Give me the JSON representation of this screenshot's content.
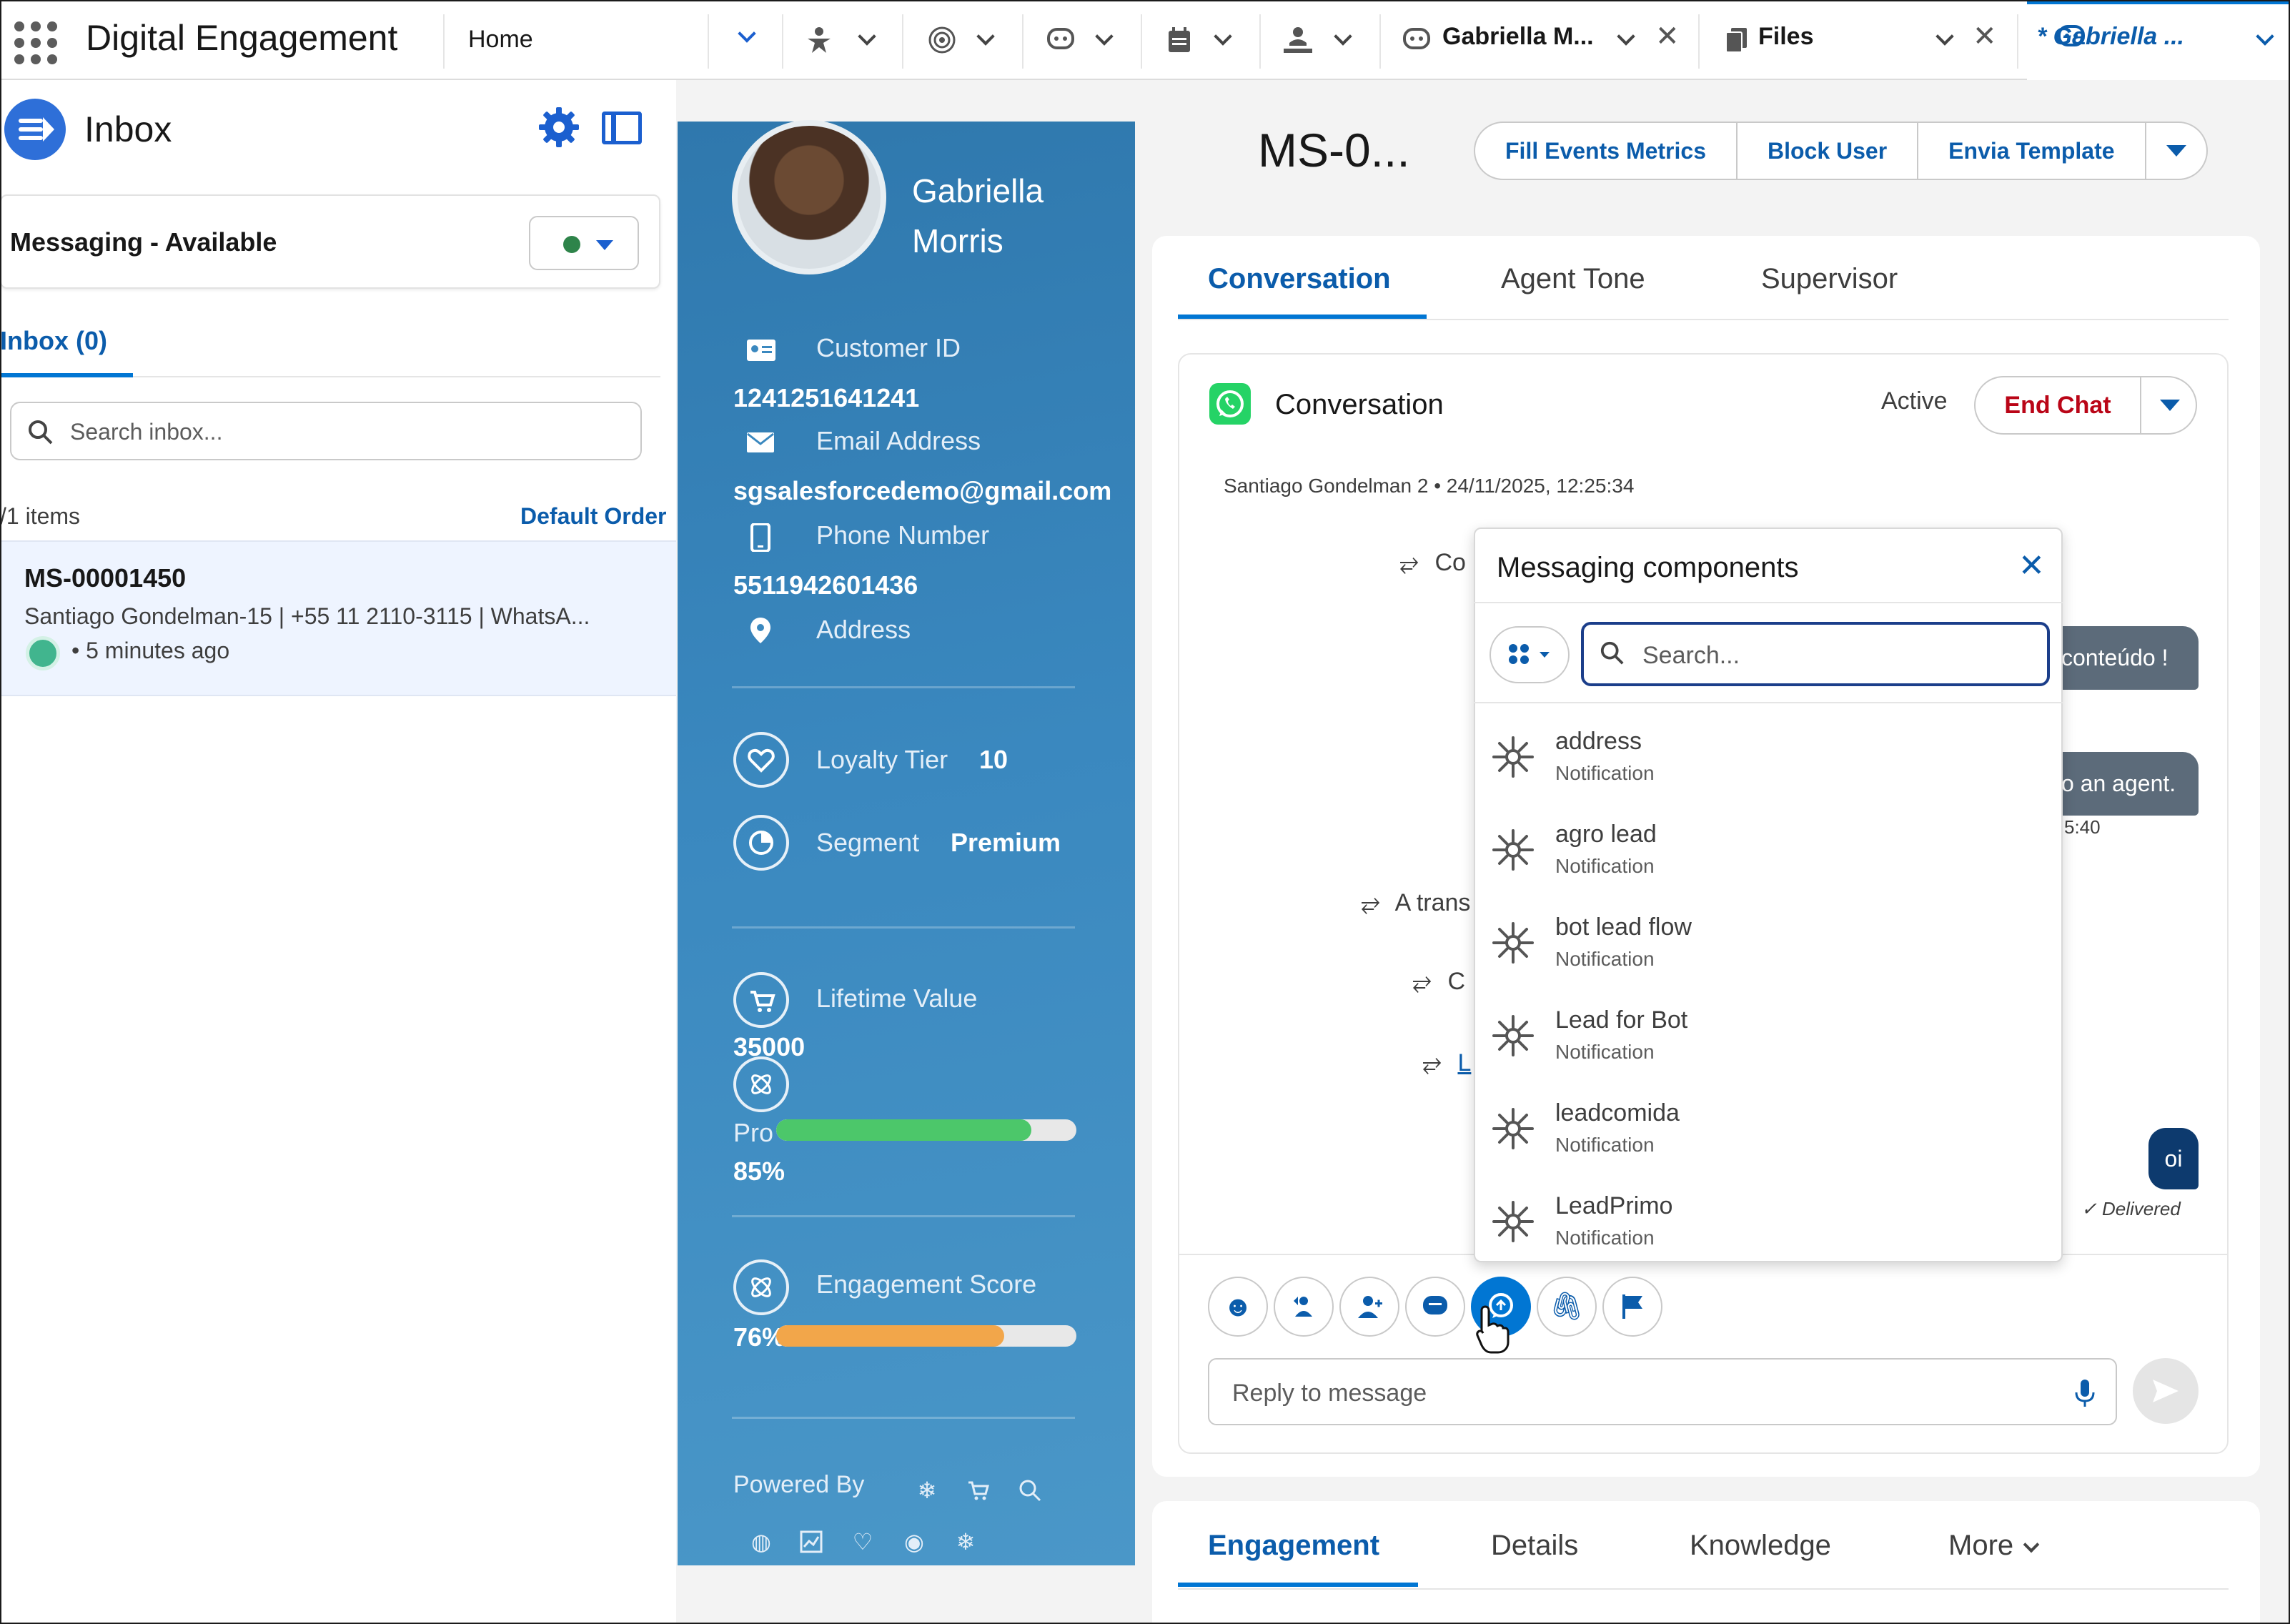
{
  "app": {
    "name": "Digital Engagement",
    "home_tab": "Home"
  },
  "nav_tabs": [
    {
      "label": "Gabriella M...",
      "icon": "chat-icon"
    },
    {
      "label": "Files",
      "icon": "files-icon"
    },
    {
      "label": "* Gabriella ...",
      "icon": "chat-icon"
    }
  ],
  "inbox": {
    "title": "Inbox",
    "status_label": "Messaging - Available",
    "tab_label": "Inbox (0)",
    "search_placeholder": "Search inbox...",
    "items_count": "/1 items",
    "sort_label": "Default Order",
    "record": {
      "id": "MS-00001450",
      "subtitle": "Santiago Gondelman-15 | +55 11 2110-3115 | WhatsA...",
      "time": "• 5 minutes ago"
    }
  },
  "customer": {
    "name_line1": "Gabriella",
    "name_line2": "Morris",
    "customer_id_label": "Customer ID",
    "customer_id": "1241251641241",
    "email_label": "Email Address",
    "email": "sgsalesforcedemo@gmail.com",
    "phone_label": "Phone Number",
    "phone": "5511942601436",
    "address_label": "Address",
    "loyalty_label": "Loyalty Tier",
    "loyalty_value": "10",
    "segment_label": "Segment",
    "segment_value": "Premium",
    "ltv_label": "Lifetime Value",
    "ltv_value": "35000",
    "prop_label": "Pro",
    "prop_percent": "85%",
    "prop_fraction": 0.85,
    "engagement_label": "Engagement Score",
    "engagement_percent": "76%",
    "engagement_fraction": 0.76,
    "powered_by": "Powered By",
    "colors": {
      "prop_bar": "#4cc76a",
      "engagement_bar": "#f2a64a"
    }
  },
  "record": {
    "title": "MS-0...",
    "actions": [
      "Fill Events Metrics",
      "Block User",
      "Envia Template"
    ],
    "tabs": [
      "Conversation",
      "Agent Tone",
      "Supervisor"
    ],
    "bottom_tabs": [
      "Engagement",
      "Details",
      "Knowledge",
      "More"
    ]
  },
  "conversation": {
    "title": "Conversation",
    "status": "Active",
    "end_chat": "End Chat",
    "meta": "Santiago Gondelman 2 • 24/11/2025, 12:25:34",
    "events": [
      "Co",
      "A trans",
      "C",
      "L"
    ],
    "bubble1": "conteúdo !",
    "bubble2": "o an agent.",
    "bubble2_time": "5:40",
    "outgoing": "oi",
    "delivered": "Delivered",
    "reply_placeholder": "Reply to message"
  },
  "popup": {
    "title": "Messaging components",
    "search_placeholder": "Search...",
    "components": [
      {
        "name": "address",
        "type": "Notification"
      },
      {
        "name": "agro lead",
        "type": "Notification"
      },
      {
        "name": "bot lead flow",
        "type": "Notification"
      },
      {
        "name": "Lead for Bot",
        "type": "Notification"
      },
      {
        "name": "leadcomida",
        "type": "Notification"
      },
      {
        "name": "LeadPrimo",
        "type": "Notification"
      }
    ]
  }
}
